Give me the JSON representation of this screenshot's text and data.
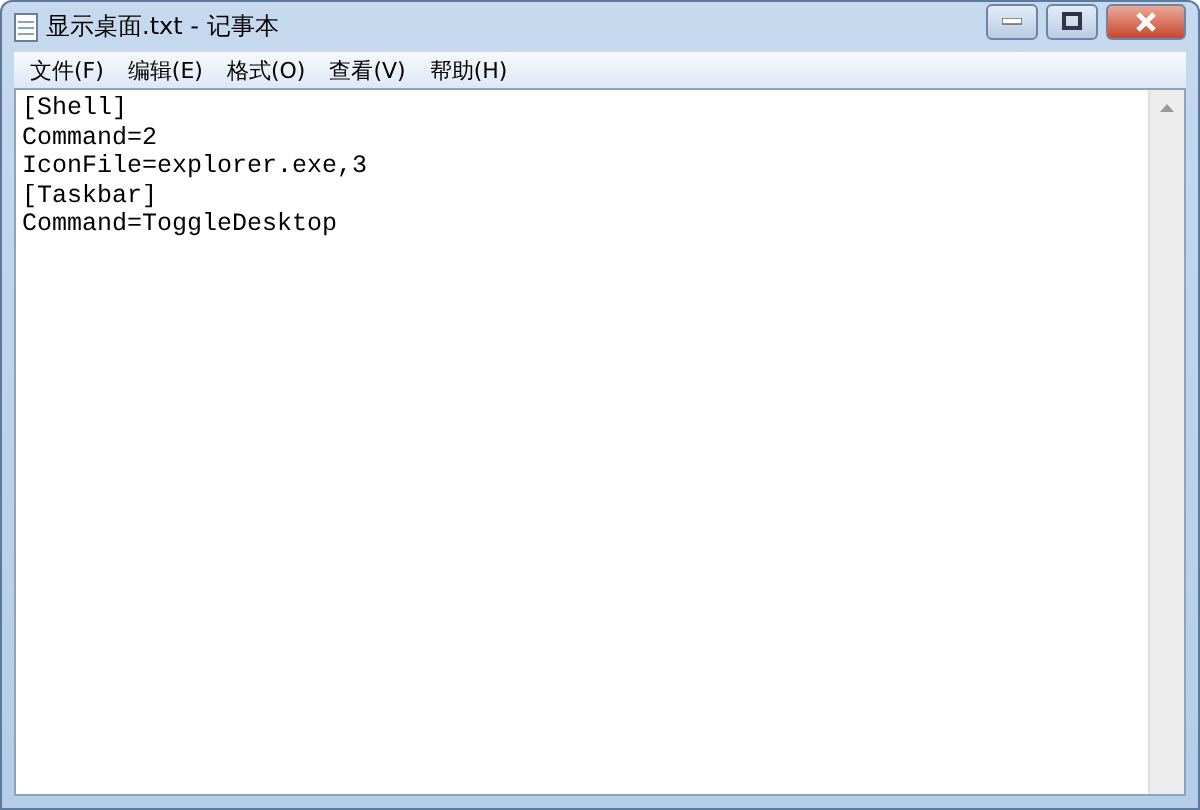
{
  "window": {
    "title": "显示桌面.txt - 记事本"
  },
  "menu": [
    "文件(F)",
    "编辑(E)",
    "格式(O)",
    "查看(V)",
    "帮助(H)"
  ],
  "lines": [
    "[Shell]",
    "Command=2",
    "IconFile=explorer.exe,3",
    "[Taskbar]",
    "Command=ToggleDesktop"
  ]
}
